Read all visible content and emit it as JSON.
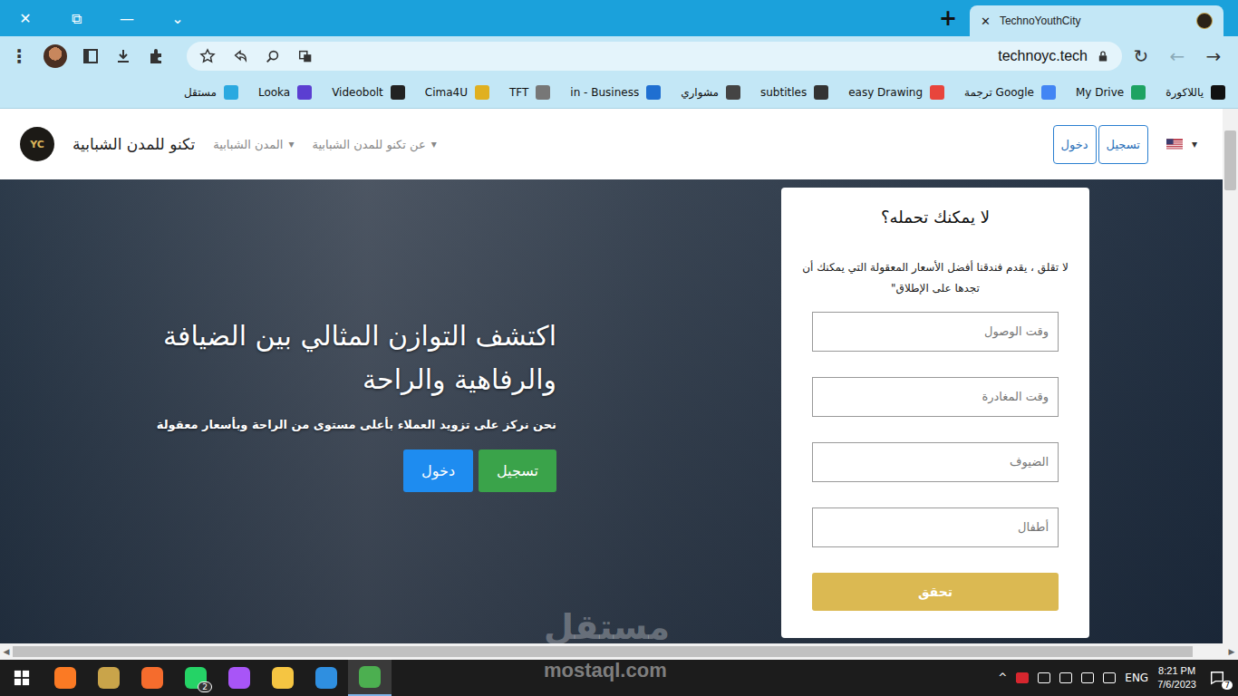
{
  "window": {
    "controls": [
      "✕",
      "⧉",
      "—",
      "⌄"
    ],
    "new_tab": "+"
  },
  "tabs": [
    {
      "label": "TechnoYouthCity",
      "close": "✕",
      "selected": true
    }
  ],
  "toolbar": {
    "menu": "⋮",
    "address": "technoyc.tech",
    "nav": [
      {
        "glyph": "↻",
        "disabled": false
      },
      {
        "glyph": "←",
        "disabled": true
      },
      {
        "glyph": "→",
        "disabled": false
      }
    ]
  },
  "bookmarks": [
    {
      "label": "ياللاكورة",
      "color": "#111111"
    },
    {
      "label": "My Drive",
      "color": "#1ea362"
    },
    {
      "label": "Google ترجمة",
      "color": "#4285f4"
    },
    {
      "label": "easy Drawing",
      "color": "#e8453c"
    },
    {
      "label": "subtitles",
      "color": "#333333"
    },
    {
      "label": "مشواري",
      "color": "#444444"
    },
    {
      "label": "in - Business",
      "color": "#1f6fd1"
    },
    {
      "label": "TFT",
      "color": "#777777"
    },
    {
      "label": "Cima4U",
      "color": "#e0b020"
    },
    {
      "label": "Videobolt",
      "color": "#222222"
    },
    {
      "label": "Looka",
      "color": "#5b3fd1"
    },
    {
      "label": "مستقل",
      "color": "#2aa9e0"
    }
  ],
  "navbar": {
    "logo": "YC",
    "brand": "تكنو للمدن الشبابية",
    "caret": "▾",
    "menus": [
      "المدن الشبابية",
      "عن تكنو للمدن الشبابية"
    ],
    "auth": [
      "دخول",
      "تسجيل"
    ]
  },
  "hero": {
    "title": "اكتشف التوازن المثالي بين الضيافة والرفاهية والراحة",
    "subtitle": "نحن نركز على تزويد العملاء بأعلى مستوى من الراحة وبأسعار معقولة",
    "buttons": [
      {
        "label": "تسجيل",
        "color": "#3aa34a"
      },
      {
        "label": "دخول",
        "color": "#1e8cf0"
      }
    ]
  },
  "booking": {
    "title": "لا يمكنك تحمله؟",
    "text": "لا تقلق ، يقدم فندقنا أفضل الأسعار المعقولة التي يمكنك أن تجدها على الإطلاق\"",
    "fields": [
      "وقت الوصول",
      "وقت المغادرة",
      "الضيوف",
      "أطفال"
    ],
    "submit": "تحقق"
  },
  "watermark": {
    "logo": "مستقل",
    "site": "mostaql.com"
  },
  "scrollbar": {
    "left": "◀",
    "right": "▶"
  },
  "taskbar": {
    "apps": [
      {
        "name": "xampp",
        "color": "#fb7a24",
        "selected": false
      },
      {
        "name": "league",
        "color": "#c9a44a",
        "selected": false
      },
      {
        "name": "origin",
        "color": "#f56c2d",
        "selected": false
      },
      {
        "name": "whatsapp",
        "color": "#25d366",
        "selected": false,
        "badge": "2"
      },
      {
        "name": "messenger",
        "color": "#a855f7",
        "selected": false
      },
      {
        "name": "explorer",
        "color": "#f5c542",
        "selected": false
      },
      {
        "name": "vscode",
        "color": "#2f8fe0",
        "selected": false
      },
      {
        "name": "chrome",
        "color": "#4caf50",
        "selected": true
      }
    ],
    "tray": {
      "chevron": "^",
      "lang": "ENG",
      "time": "8:21 PM",
      "date": "7/6/2023",
      "notifications": "7"
    }
  }
}
